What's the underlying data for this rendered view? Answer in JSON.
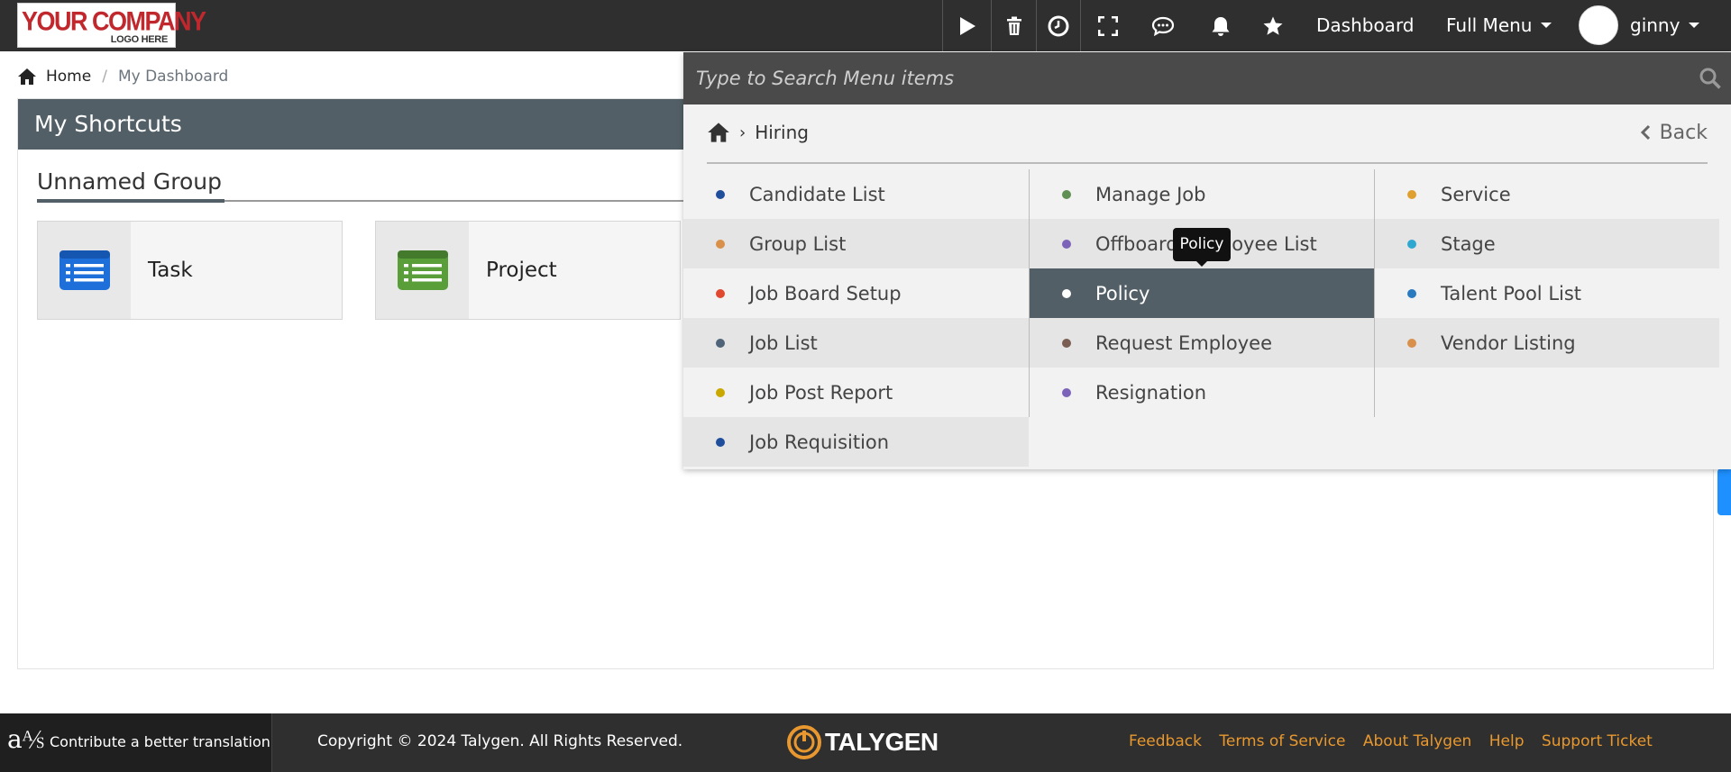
{
  "header": {
    "logo_line1": "YOUR COMPANY",
    "logo_line2": "LOGO HERE",
    "icons": [
      "play-icon",
      "trash-icon",
      "clock-icon",
      "fullscreen-icon",
      "chat-icon",
      "bell-icon",
      "star-icon"
    ],
    "dashboard_label": "Dashboard",
    "full_menu_label": "Full Menu",
    "username": "ginny"
  },
  "breadcrumb": {
    "home": "Home",
    "current": "My Dashboard"
  },
  "shortcuts": {
    "title": "My Shortcuts",
    "group_title": "Unnamed Group",
    "tiles": [
      {
        "label": "Task",
        "icon_color": "#1e6fd9"
      },
      {
        "label": "Project",
        "icon_color": "#5a9e3a"
      }
    ]
  },
  "menu": {
    "search_placeholder": "Type to Search Menu items",
    "path_current": "Hiring",
    "back_label": "Back",
    "columns": [
      [
        {
          "label": "Candidate List",
          "dot": "#1f4e9c"
        },
        {
          "label": "Group List",
          "dot": "#d9904a"
        },
        {
          "label": "Job Board Setup",
          "dot": "#e0482f"
        },
        {
          "label": "Job List",
          "dot": "#4f6478"
        },
        {
          "label": "Job Post Report",
          "dot": "#c9a800"
        },
        {
          "label": "Job Requisition",
          "dot": "#1f4e9c"
        }
      ],
      [
        {
          "label": "Manage Job",
          "dot": "#5f8f52"
        },
        {
          "label": "Offboard Employee List",
          "dot": "#7a63b8"
        },
        {
          "label": "Policy",
          "dot": "#ffffff"
        },
        {
          "label": "Request Employee",
          "dot": "#7a5e52"
        },
        {
          "label": "Resignation",
          "dot": "#7a63b8"
        }
      ],
      [
        {
          "label": "Service",
          "dot": "#e0a030"
        },
        {
          "label": "Stage",
          "dot": "#2ea8d0"
        },
        {
          "label": "Talent Pool List",
          "dot": "#2a7ac0"
        },
        {
          "label": "Vendor Listing",
          "dot": "#d9904a"
        }
      ]
    ],
    "tooltip": "Policy"
  },
  "footer": {
    "contribute": "Contribute a better translation",
    "copyright": "Copyright © 2024 Talygen. All Rights Reserved.",
    "brand": "TALYGEN",
    "links": [
      "Feedback",
      "Terms of Service",
      "About Talygen",
      "Help",
      "Support Ticket"
    ]
  }
}
